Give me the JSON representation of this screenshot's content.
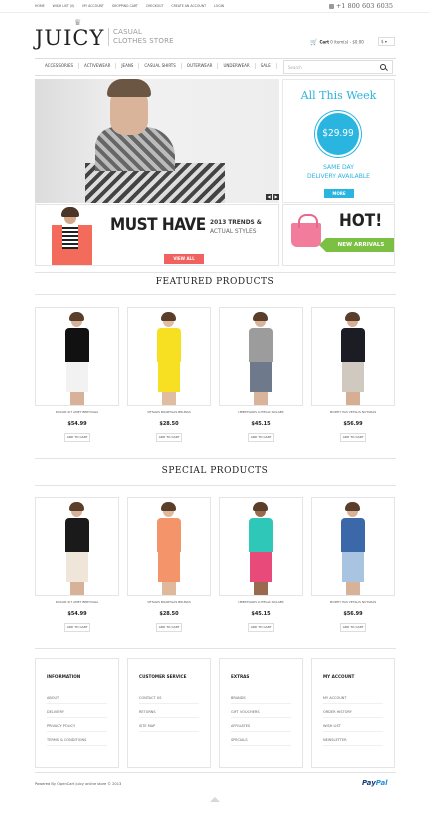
{
  "top_links": [
    "Home",
    "Wish List (0)",
    "My Account",
    "Shopping Cart",
    "Checkout",
    "Create an account",
    "Login"
  ],
  "phone": "+1 800 603 6035",
  "logo": "JUICY",
  "tagline": "Casual clothes store",
  "cart": {
    "label": "Cart",
    "summary": "0 item(s) - $0.00"
  },
  "currency": "$",
  "nav": [
    "Accessories",
    "Activewear",
    "Jeans",
    "Casual Shirts",
    "Outerwear",
    "Underwear",
    "Sale"
  ],
  "search_placeholder": "Search",
  "promo": {
    "title": "All This Week",
    "price": "$29.99",
    "line1": "Same Day",
    "line2": "Delivery Available",
    "button": "More"
  },
  "banner_must": {
    "title": "MUST HAVE",
    "sub1": "2013 Trends &",
    "sub2": "Actual Styles",
    "button": "View All"
  },
  "banner_hot": {
    "title": "HOT!",
    "ribbon": "New Arrivals"
  },
  "featured_title": "Featured products",
  "special_title": "Special products",
  "add_to_cart": "Add to cart",
  "featured": [
    {
      "name": "Dolor Sit Amet Bertvaga",
      "price": "$54.99"
    },
    {
      "name": "Vetagis Boartgas Brunas",
      "price": "$28.50"
    },
    {
      "name": "Ubertvaris Lutegia Solaer",
      "price": "$45.15"
    },
    {
      "name": "Morth Has Vetalis Nuturas",
      "price": "$56.99"
    }
  ],
  "special": [
    {
      "name": "Dolor Sit Amet Bertvaga",
      "price": "$54.99"
    },
    {
      "name": "Vetagis Boartgas Brunas",
      "price": "$28.50"
    },
    {
      "name": "Ubertvaris Lutegia Solaer",
      "price": "$45.15"
    },
    {
      "name": "Morth Has Vetalis Nuturas",
      "price": "$56.99"
    }
  ],
  "footer": [
    {
      "title": "Information",
      "links": [
        "About",
        "Delivery",
        "Privacy Policy",
        "Terms & Conditions"
      ]
    },
    {
      "title": "Customer Service",
      "links": [
        "Contact Us",
        "Returns",
        "Site Map"
      ]
    },
    {
      "title": "Extras",
      "links": [
        "Brands",
        "Gift Vouchers",
        "Affiliates",
        "Specials"
      ]
    },
    {
      "title": "My Account",
      "links": [
        "My Account",
        "Order History",
        "Wish List",
        "Newsletter"
      ]
    }
  ],
  "powered": "Powered By OpenCart Juicy online store © 2013",
  "paypal_a": "Pay",
  "paypal_b": "Pal",
  "colors": {
    "accent_blue": "#29b5e0",
    "accent_red": "#f0625f",
    "accent_green": "#7cc043",
    "cart_icon": "#e44444"
  }
}
